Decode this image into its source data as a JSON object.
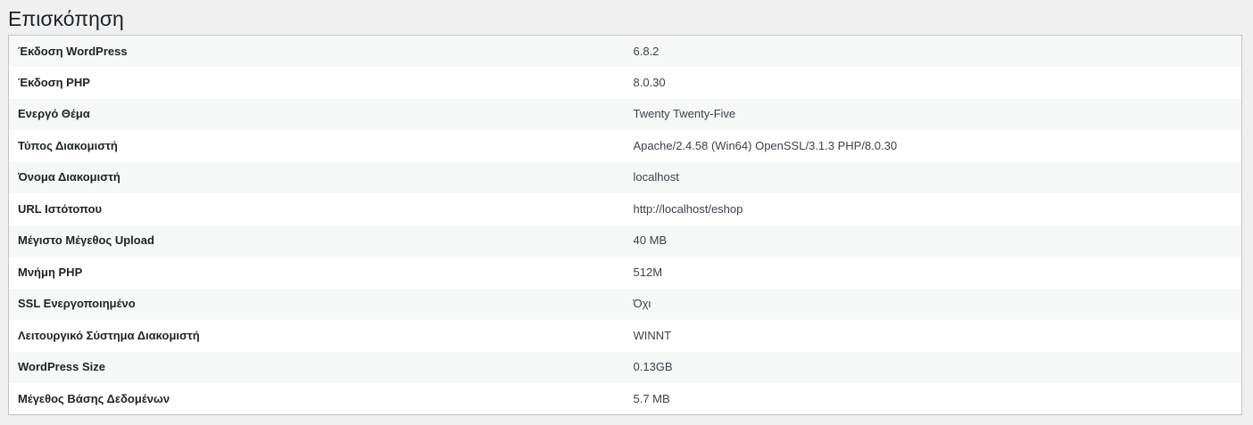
{
  "page": {
    "title": "Επισκόπηση"
  },
  "rows": [
    {
      "label": "Έκδοση WordPress",
      "value": "6.8.2"
    },
    {
      "label": "Έκδοση PHP",
      "value": "8.0.30"
    },
    {
      "label": "Ενεργό Θέμα",
      "value": "Twenty Twenty-Five"
    },
    {
      "label": "Τύπος Διακομιστή",
      "value": "Apache/2.4.58 (Win64) OpenSSL/3.1.3 PHP/8.0.30"
    },
    {
      "label": "Όνομα Διακομιστή",
      "value": "localhost"
    },
    {
      "label": "URL Ιστότοπου",
      "value": "http://localhost/eshop"
    },
    {
      "label": "Μέγιστο Μέγεθος Upload",
      "value": "40 MB"
    },
    {
      "label": "Μνήμη PHP",
      "value": "512M"
    },
    {
      "label": "SSL Ενεργοποιημένο",
      "value": "Όχι"
    },
    {
      "label": "Λειτουργικό Σύστημα Διακομιστή",
      "value": "WINNT"
    },
    {
      "label": "WordPress Size",
      "value": "0.13GB"
    },
    {
      "label": "Μέγεθος Βάσης Δεδομένων",
      "value": "5.7 MB"
    }
  ]
}
